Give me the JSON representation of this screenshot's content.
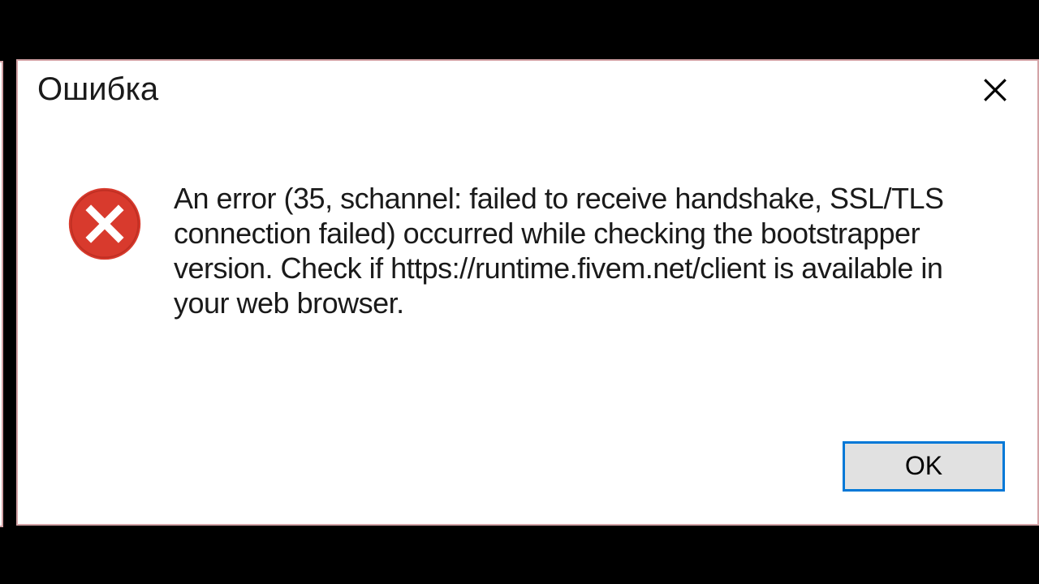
{
  "dialog": {
    "title": "Ошибка",
    "message": "An error (35, schannel: failed to receive handshake, SSL/TLS connection failed) occurred while checking the bootstrapper version. Check if https://runtime.fivem.net/client is available in your web browser.",
    "ok_label": "OK"
  },
  "icons": {
    "close": "close-icon",
    "error": "error-icon"
  },
  "colors": {
    "error_red": "#d83a2d",
    "focus_blue": "#0078d7",
    "border_pink": "#d3a3a6"
  }
}
